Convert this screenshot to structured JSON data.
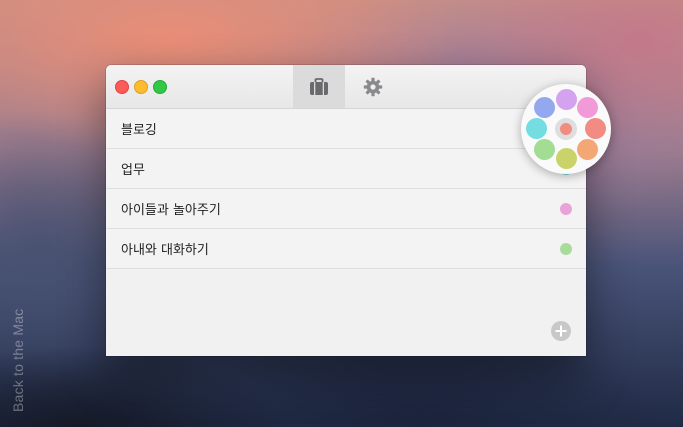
{
  "background": {
    "side_text": "Back to the Mac"
  },
  "toolbar": {
    "tabs": [
      {
        "name": "briefcase-icon",
        "active": true
      },
      {
        "name": "gear-icon",
        "active": false
      }
    ]
  },
  "list": {
    "items": [
      {
        "label": "블로깅",
        "color": "#f28b82"
      },
      {
        "label": "업무",
        "color": "#66d9dc"
      },
      {
        "label": "아이들과 놀아주기",
        "color": "#e8a4d8"
      },
      {
        "label": "아내와 대화하기",
        "color": "#a8dc9a"
      }
    ]
  },
  "footer": {
    "add_icon": "plus-circle-icon"
  },
  "color_picker": {
    "selected": "#f28b82",
    "swatches": [
      "#d3a3ef",
      "#f19ad8",
      "#f28b82",
      "#f3a774",
      "#c9d36a",
      "#a3dc93",
      "#73dde2",
      "#94a8ef"
    ]
  }
}
